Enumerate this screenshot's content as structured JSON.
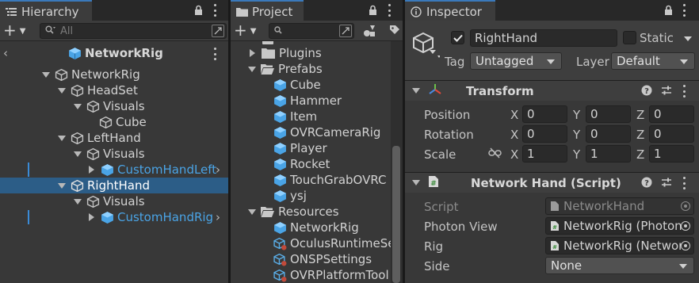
{
  "hierarchy": {
    "tab_label": "Hierarchy",
    "search_placeholder": "All",
    "scene_title": "NetworkRig",
    "rows": [
      {
        "label": "NetworkRig"
      },
      {
        "label": "HeadSet"
      },
      {
        "label": "Visuals"
      },
      {
        "label": "Cube"
      },
      {
        "label": "LeftHand"
      },
      {
        "label": "Visuals"
      },
      {
        "label": "CustomHandLeft"
      },
      {
        "label": "RightHand"
      },
      {
        "label": "Visuals"
      },
      {
        "label": "CustomHandRigh"
      }
    ]
  },
  "project": {
    "tab_label": "Project",
    "items": [
      {
        "label": "Plugins"
      },
      {
        "label": "Prefabs"
      },
      {
        "label": "Cube"
      },
      {
        "label": "Hammer"
      },
      {
        "label": "Item"
      },
      {
        "label": "OVRCameraRig"
      },
      {
        "label": "Player"
      },
      {
        "label": "Rocket"
      },
      {
        "label": "TouchGrabOVRC"
      },
      {
        "label": "ysj"
      },
      {
        "label": "Resources"
      },
      {
        "label": "NetworkRig"
      },
      {
        "label": "OculusRuntimeSe"
      },
      {
        "label": "ONSPSettings"
      },
      {
        "label": "OVRPlatformTool"
      }
    ]
  },
  "inspector": {
    "tab_label": "Inspector",
    "object_name": "RightHand",
    "static_label": "Static",
    "tag_label": "Tag",
    "tag_value": "Untagged",
    "layer_label": "Layer",
    "layer_value": "Default",
    "transform": {
      "title": "Transform",
      "rows": [
        {
          "label": "Position",
          "x": "0",
          "y": "0",
          "z": "0"
        },
        {
          "label": "Rotation",
          "x": "0",
          "y": "0",
          "z": "0"
        },
        {
          "label": "Scale",
          "x": "1",
          "y": "1",
          "z": "1"
        }
      ],
      "axis_x": "X",
      "axis_y": "Y",
      "axis_z": "Z"
    },
    "network_hand": {
      "title": "Network Hand (Script)",
      "script_label": "Script",
      "script_value": "NetworkHand",
      "photon_view_label": "Photon View",
      "photon_view_value": "NetworkRig (Photon",
      "rig_label": "Rig",
      "rig_value": "NetworkRig (Networ",
      "side_label": "Side",
      "side_value": "None"
    }
  }
}
